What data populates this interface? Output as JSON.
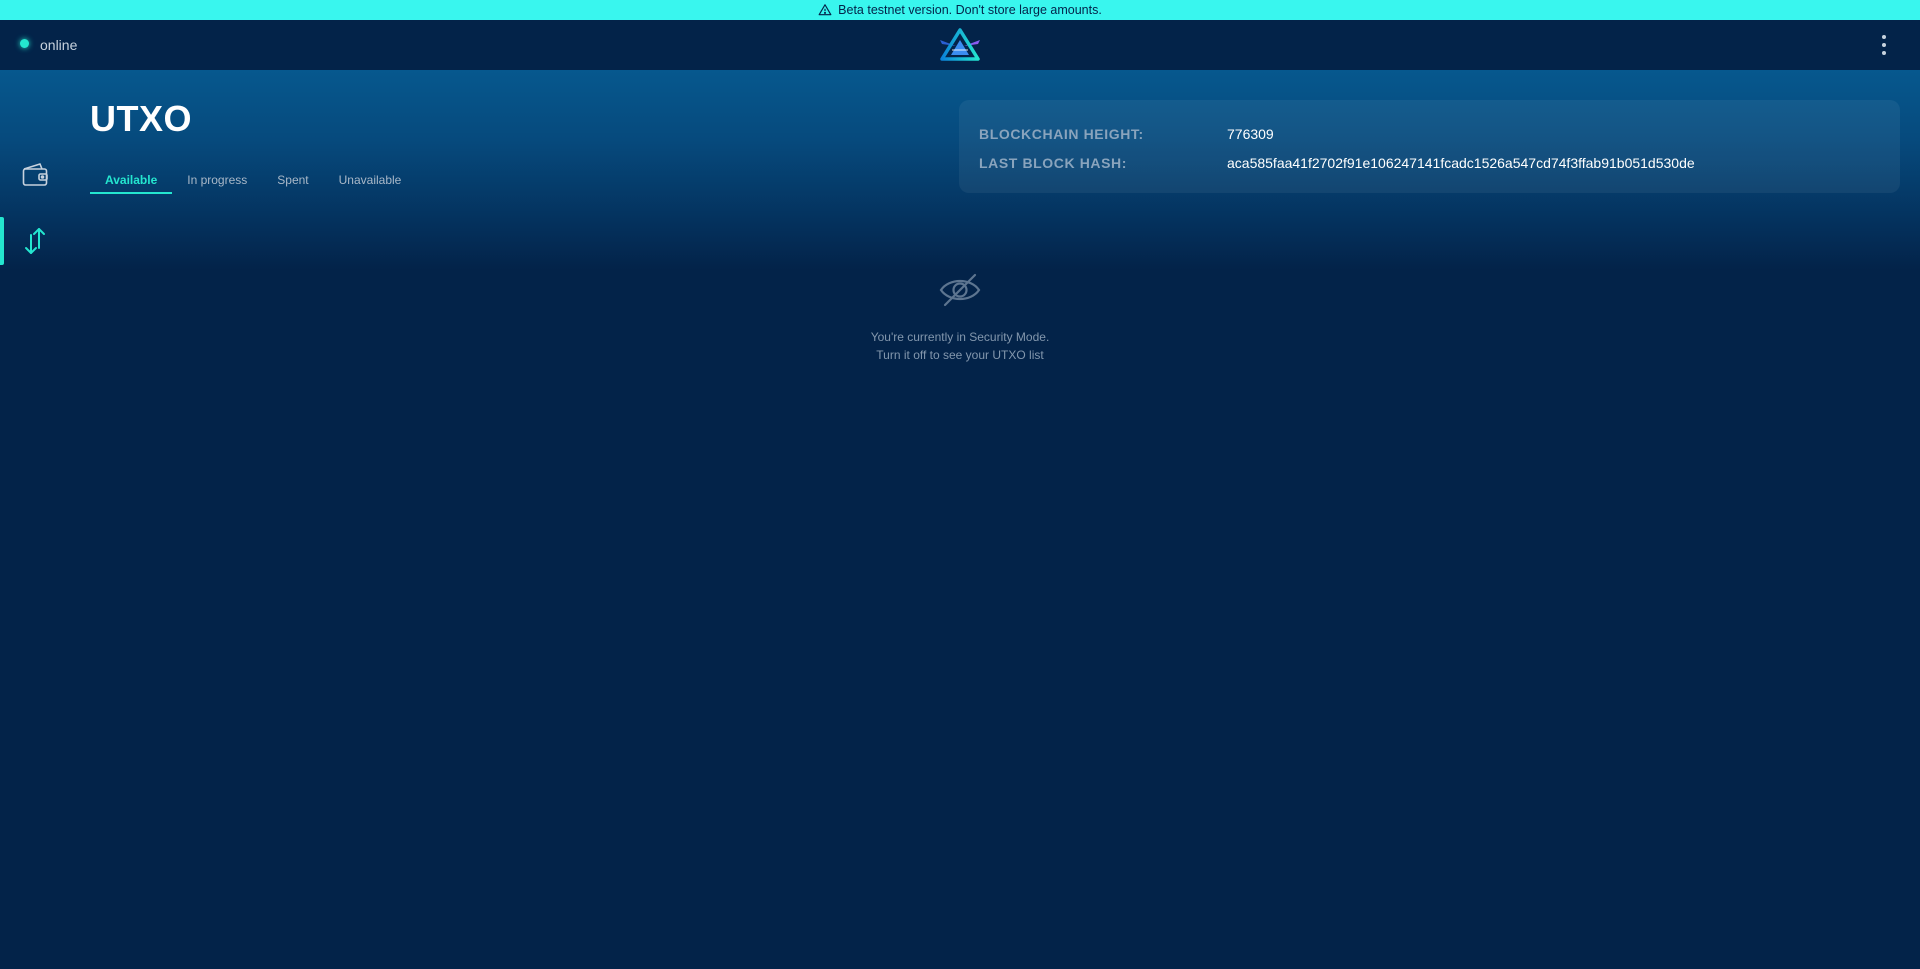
{
  "banner": {
    "text": "Beta testnet version. Don't store large amounts.",
    "icon": "warning-icon"
  },
  "header": {
    "status": {
      "label": "online",
      "color": "#24e6cf"
    },
    "logo": "beam-logo",
    "menu_icon": "more-vertical-icon"
  },
  "sidebar": {
    "items": [
      {
        "name": "wallet",
        "icon": "wallet-icon",
        "active": false
      },
      {
        "name": "utxo",
        "icon": "arrows-up-down-icon",
        "active": true
      }
    ]
  },
  "main": {
    "title": "UTXO",
    "tabs": [
      {
        "label": "Available",
        "active": true
      },
      {
        "label": "In progress",
        "active": false
      },
      {
        "label": "Spent",
        "active": false
      },
      {
        "label": "Unavailable",
        "active": false
      }
    ]
  },
  "blockchain": {
    "height_label": "BLOCKCHAIN HEIGHT:",
    "height_value": "776309",
    "hash_label": "LAST BLOCK HASH:",
    "hash_value": "aca585faa41f2702f91e106247141fcadc1526a547cd74f3ffab91b051d530de"
  },
  "empty_state": {
    "icon": "eye-off-icon",
    "line1": "You're currently in Security Mode.",
    "line2": "Turn it off to see your UTXO list"
  },
  "colors": {
    "accent": "#24e6cf",
    "banner": "#39f6ee",
    "background": "#032349"
  }
}
